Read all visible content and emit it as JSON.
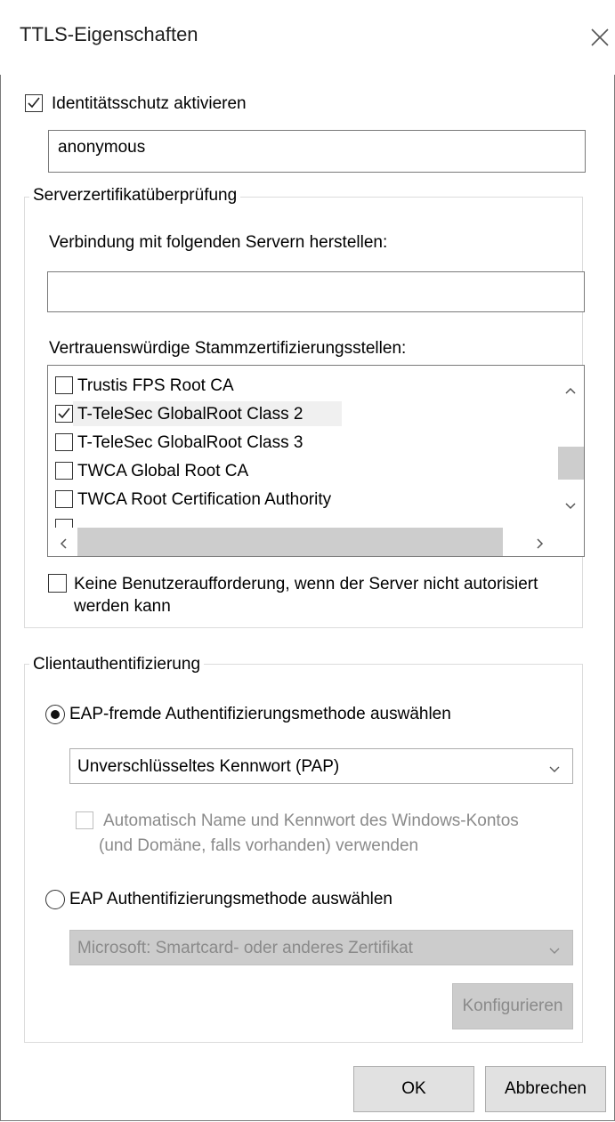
{
  "window": {
    "title": "TTLS-Eigenschaften"
  },
  "identity": {
    "checkbox_label": "Identitätsschutz aktivieren",
    "checked": true,
    "value": "anonymous"
  },
  "server_cert": {
    "group_label": "Serverzertifikatüberprüfung",
    "connect_label": "Verbindung mit folgenden Servern herstellen:",
    "connect_value": "",
    "trusted_label": "Vertrauenswürdige Stammzertifizierungsstellen:",
    "items": [
      {
        "label": "Trustis FPS Root CA",
        "checked": false
      },
      {
        "label": "T-TeleSec GlobalRoot Class 2",
        "checked": true
      },
      {
        "label": "T-TeleSec GlobalRoot Class 3",
        "checked": false
      },
      {
        "label": "TWCA Global Root CA",
        "checked": false
      },
      {
        "label": "TWCA Root Certification Authority",
        "checked": false
      }
    ],
    "no_prompt_label_line1": "Keine Benutzeraufforderung, wenn der Server nicht autorisiert",
    "no_prompt_label_line2": "werden kann",
    "no_prompt_checked": false
  },
  "client_auth": {
    "group_label": "Clientauthentifizierung",
    "non_eap_label": "EAP-fremde Authentifizierungsmethode auswählen",
    "non_eap_selected": true,
    "non_eap_value": "Unverschlüsseltes Kennwort (PAP)",
    "auto_label_line1": "Automatisch Name und Kennwort des Windows-Kontos",
    "auto_label_line2": "(und Domäne, falls vorhanden) verwenden",
    "eap_label": "EAP Authentifizierungsmethode auswählen",
    "eap_selected": false,
    "eap_value": "Microsoft: Smartcard- oder anderes Zertifikat",
    "configure_label": "Konfigurieren"
  },
  "footer": {
    "ok_label": "OK",
    "cancel_label": "Abbrechen"
  },
  "icons": {
    "close": "close-icon",
    "check": "checkmark-icon",
    "scroll_up": "chevron-up-icon",
    "scroll_down": "chevron-down-icon",
    "scroll_left": "chevron-left-icon",
    "scroll_right": "chevron-right-icon",
    "dropdown": "chevron-down-icon"
  },
  "colors": {
    "window_border": "#7a7a7a",
    "selection_highlight": "#f0f0f0",
    "disabled_text": "#8a8a8a"
  }
}
